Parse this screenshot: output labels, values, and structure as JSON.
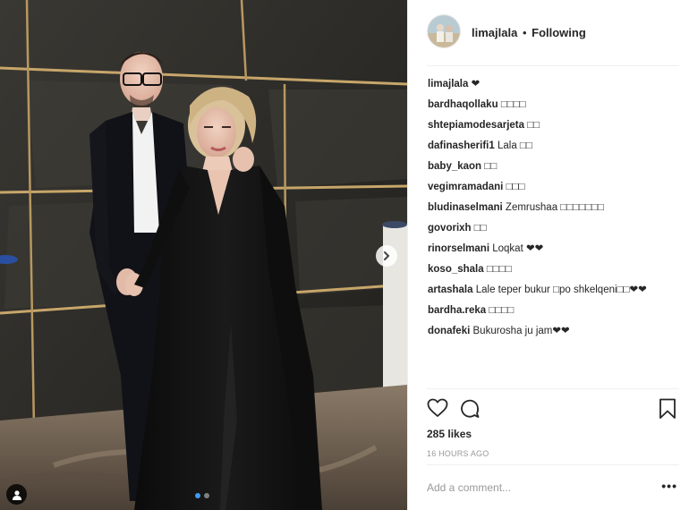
{
  "header": {
    "username": "limajlala",
    "separator": "•",
    "follow_label": "Following",
    "avatar": "avatar-photo"
  },
  "comments": [
    {
      "user": "limajlala",
      "text": "❤"
    },
    {
      "user": "bardhaqollaku",
      "text": "□□□□"
    },
    {
      "user": "shtepiamodesarjeta",
      "text": "□□"
    },
    {
      "user": "dafinasherifi1",
      "text": "Lala □□"
    },
    {
      "user": "baby_kaon",
      "text": "□□"
    },
    {
      "user": "vegimramadani",
      "text": "□□□"
    },
    {
      "user": "bludinaselmani",
      "text": "Zemrushaa □□□□□□□"
    },
    {
      "user": "govorixh",
      "text": "□□"
    },
    {
      "user": "rinorselmani",
      "text": "Loqkat ❤❤"
    },
    {
      "user": "koso_shala",
      "text": "□□□□"
    },
    {
      "user": "artashala",
      "text": "Lale teper bukur □po shkelqeni□□❤❤"
    },
    {
      "user": "bardha.reka",
      "text": "□□□□"
    },
    {
      "user": "donafeki",
      "text": "Bukurosha ju jam❤❤"
    }
  ],
  "actions": {
    "like_icon": "heart-icon",
    "comment_icon": "comment-icon",
    "save_icon": "bookmark-icon"
  },
  "likes": "285 likes",
  "timestamp": "16 HOURS AGO",
  "comment_box": {
    "placeholder": "Add a comment...",
    "more_label": "•••"
  },
  "media": {
    "description_icon_next": "chevron-right-icon",
    "tag_icon": "user-tag-icon",
    "carousel_index": 1,
    "carousel_total": 2
  },
  "colors": {
    "text": "#262626",
    "muted": "#999999",
    "divider": "#efefef",
    "carousel_active": "#3f9bf0"
  }
}
